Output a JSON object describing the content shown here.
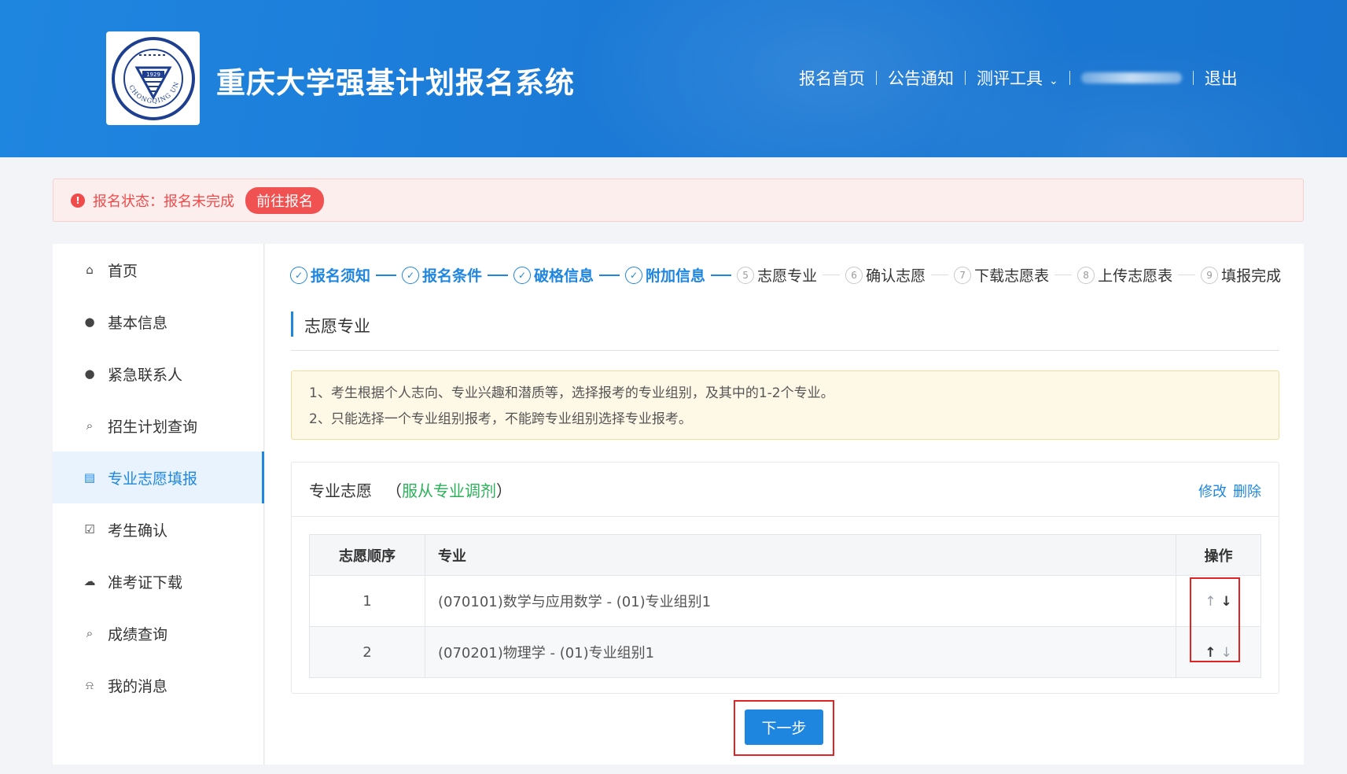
{
  "header": {
    "site_title": "重庆大学强基计划报名系统",
    "logo": {
      "icon": "university-seal-icon",
      "year": "1929",
      "ring_text": "CHONGQING UNIVERSITY"
    },
    "nav": {
      "home": "报名首页",
      "notices": "公告通知",
      "tools": "测评工具",
      "logout": "退出"
    }
  },
  "alert": {
    "status_text": "报名状态：报名未完成",
    "go_button": "前往报名",
    "color": "#ef4b4b"
  },
  "sidebar": {
    "items": [
      {
        "label": "首页",
        "icon": "home-icon"
      },
      {
        "label": "基本信息",
        "icon": "user-icon"
      },
      {
        "label": "紧急联系人",
        "icon": "user-icon"
      },
      {
        "label": "招生计划查询",
        "icon": "search-icon"
      },
      {
        "label": "专业志愿填报",
        "icon": "document-icon",
        "active": true
      },
      {
        "label": "考生确认",
        "icon": "checkbox-icon"
      },
      {
        "label": "准考证下载",
        "icon": "cloud-download-icon"
      },
      {
        "label": "成绩查询",
        "icon": "search-icon"
      },
      {
        "label": "我的消息",
        "icon": "bell-icon"
      }
    ]
  },
  "steps": [
    {
      "num": "✓",
      "label": "报名须知",
      "done": true
    },
    {
      "num": "✓",
      "label": "报名条件",
      "done": true
    },
    {
      "num": "✓",
      "label": "破格信息",
      "done": true
    },
    {
      "num": "✓",
      "label": "附加信息",
      "done": true
    },
    {
      "num": "5",
      "label": "志愿专业",
      "done": false
    },
    {
      "num": "6",
      "label": "确认志愿",
      "done": false
    },
    {
      "num": "7",
      "label": "下载志愿表",
      "done": false
    },
    {
      "num": "8",
      "label": "上传志愿表",
      "done": false
    },
    {
      "num": "9",
      "label": "填报完成",
      "done": false
    }
  ],
  "section": {
    "title": "志愿专业"
  },
  "notice": {
    "line1": "1、考生根据个人志向、专业兴趣和潜质等，选择报考的专业组别，及其中的1-2个专业。",
    "line2": "2、只能选择一个专业组别报考，不能跨专业组别选择专业报考。"
  },
  "card": {
    "title": "专业志愿",
    "adjust_open": "（",
    "adjust_text": "服从专业调剂",
    "adjust_close": "）",
    "edit": "修改",
    "delete": "删除"
  },
  "table": {
    "headers": [
      "志愿顺序",
      "专业",
      "操作"
    ],
    "rows": [
      {
        "order": "1",
        "major": "(070101)数学与应用数学 - (01)专业组别1"
      },
      {
        "order": "2",
        "major": "(070201)物理学 - (01)专业组别1"
      }
    ]
  },
  "next_button": "下一步",
  "colors": {
    "primary": "#1f86e0",
    "success": "#2bb15a",
    "danger": "#e02424"
  }
}
